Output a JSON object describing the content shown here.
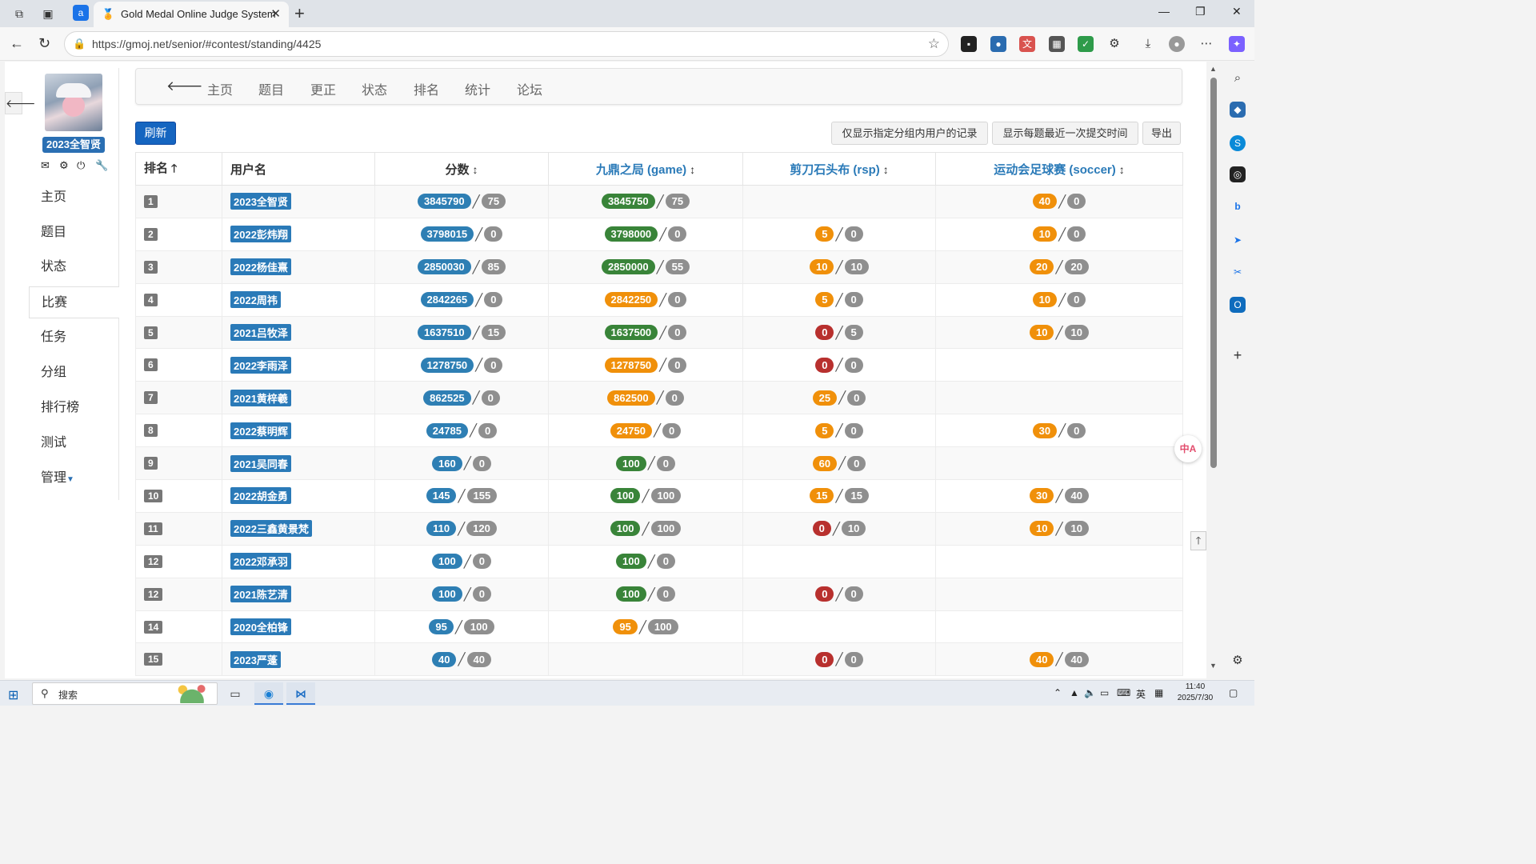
{
  "browser": {
    "tab_title": "Gold Medal Online Judge System",
    "tab_badge": "a",
    "url": "https://gmoj.net/senior/#contest/standing/4425"
  },
  "sidebar": {
    "username": "2023全智贤",
    "items": [
      {
        "label": "主页"
      },
      {
        "label": "题目"
      },
      {
        "label": "状态"
      },
      {
        "label": "比赛",
        "active": true
      },
      {
        "label": "任务"
      },
      {
        "label": "分组"
      },
      {
        "label": "排行榜"
      },
      {
        "label": "测试"
      },
      {
        "label": "管理"
      }
    ]
  },
  "topnav": {
    "items": [
      "主页",
      "题目",
      "更正",
      "状态",
      "排名",
      "统计",
      "论坛"
    ]
  },
  "toolbar": {
    "refresh": "刷新",
    "filter_group": "仅显示指定分组内用户的记录",
    "show_last_submit": "显示每题最近一次提交时间",
    "export": "导出"
  },
  "table": {
    "headers": {
      "rank": "排名",
      "user": "用户名",
      "score": "分数",
      "p1": "九鼎之局 (game)",
      "p2": "剪刀石头布 (rsp)",
      "p3": "运动会足球赛 (soccer)"
    },
    "rows": [
      {
        "rank": "1",
        "user": "2023全智贤",
        "total": [
          "3845790",
          "75"
        ],
        "p1": [
          "3845750",
          "75",
          "green"
        ],
        "p2": null,
        "p3": [
          "40",
          "0",
          "orange"
        ]
      },
      {
        "rank": "2",
        "user": "2022彭炜翔",
        "total": [
          "3798015",
          "0"
        ],
        "p1": [
          "3798000",
          "0",
          "green"
        ],
        "p2": [
          "5",
          "0",
          "orange"
        ],
        "p3": [
          "10",
          "0",
          "orange"
        ]
      },
      {
        "rank": "3",
        "user": "2022杨佳熹",
        "total": [
          "2850030",
          "85"
        ],
        "p1": [
          "2850000",
          "55",
          "green"
        ],
        "p2": [
          "10",
          "10",
          "orange"
        ],
        "p3": [
          "20",
          "20",
          "orange"
        ]
      },
      {
        "rank": "4",
        "user": "2022周祎",
        "total": [
          "2842265",
          "0"
        ],
        "p1": [
          "2842250",
          "0",
          "orange"
        ],
        "p2": [
          "5",
          "0",
          "orange"
        ],
        "p3": [
          "10",
          "0",
          "orange"
        ]
      },
      {
        "rank": "5",
        "user": "2021吕牧泽",
        "total": [
          "1637510",
          "15"
        ],
        "p1": [
          "1637500",
          "0",
          "green"
        ],
        "p2": [
          "0",
          "5",
          "red"
        ],
        "p3": [
          "10",
          "10",
          "orange"
        ]
      },
      {
        "rank": "6",
        "user": "2022李雨泽",
        "total": [
          "1278750",
          "0"
        ],
        "p1": [
          "1278750",
          "0",
          "orange"
        ],
        "p2": [
          "0",
          "0",
          "red"
        ],
        "p3": null
      },
      {
        "rank": "7",
        "user": "2021黄梓羲",
        "total": [
          "862525",
          "0"
        ],
        "p1": [
          "862500",
          "0",
          "orange"
        ],
        "p2": [
          "25",
          "0",
          "orange"
        ],
        "p3": null
      },
      {
        "rank": "8",
        "user": "2022蔡明辉",
        "total": [
          "24785",
          "0"
        ],
        "p1": [
          "24750",
          "0",
          "orange"
        ],
        "p2": [
          "5",
          "0",
          "orange"
        ],
        "p3": [
          "30",
          "0",
          "orange"
        ]
      },
      {
        "rank": "9",
        "user": "2021吴同春",
        "total": [
          "160",
          "0"
        ],
        "p1": [
          "100",
          "0",
          "green"
        ],
        "p2": [
          "60",
          "0",
          "orange"
        ],
        "p3": null
      },
      {
        "rank": "10",
        "user": "2022胡金勇",
        "total": [
          "145",
          "155"
        ],
        "p1": [
          "100",
          "100",
          "green"
        ],
        "p2": [
          "15",
          "15",
          "orange"
        ],
        "p3": [
          "30",
          "40",
          "orange"
        ]
      },
      {
        "rank": "11",
        "user": "2022三鑫黄景梵",
        "total": [
          "110",
          "120"
        ],
        "p1": [
          "100",
          "100",
          "green"
        ],
        "p2": [
          "0",
          "10",
          "red"
        ],
        "p3": [
          "10",
          "10",
          "orange"
        ]
      },
      {
        "rank": "12",
        "user": "2022邓承羽",
        "total": [
          "100",
          "0"
        ],
        "p1": [
          "100",
          "0",
          "green"
        ],
        "p2": null,
        "p3": null
      },
      {
        "rank": "12",
        "user": "2021陈艺清",
        "total": [
          "100",
          "0"
        ],
        "p1": [
          "100",
          "0",
          "green"
        ],
        "p2": [
          "0",
          "0",
          "red"
        ],
        "p3": null
      },
      {
        "rank": "14",
        "user": "2020全柏锋",
        "total": [
          "95",
          "100"
        ],
        "p1": [
          "95",
          "100",
          "orange"
        ],
        "p2": null,
        "p3": null
      },
      {
        "rank": "15",
        "user": "2023严蓬",
        "total": [
          "40",
          "40"
        ],
        "p1": null,
        "p2": [
          "0",
          "0",
          "red"
        ],
        "p3": [
          "40",
          "40",
          "orange"
        ]
      }
    ]
  },
  "translate_icon": "中A",
  "taskbar": {
    "search_placeholder": "搜索",
    "ime": "英",
    "time": "11:40",
    "date": "2025/7/30"
  },
  "colors": {
    "total_pill": "#2e7fb4",
    "ac_pill": "#398439",
    "partial_pill": "#f0900a",
    "zero_pill": "#b8302e",
    "penalty_pill": "#8f8f8f",
    "user_label": "#2a7ab8",
    "refresh_button": "#1565c0"
  }
}
